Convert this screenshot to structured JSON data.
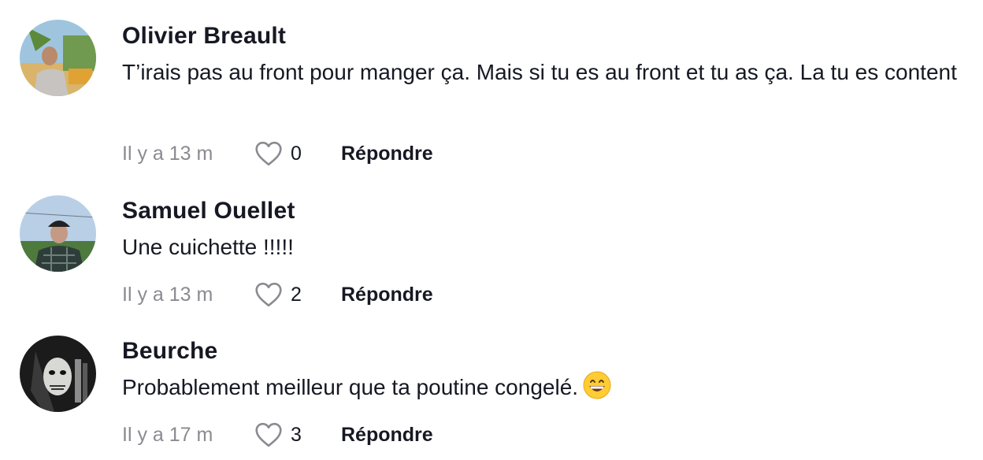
{
  "comments": [
    {
      "username": "Olivier Breault",
      "text": "T’irais pas au front pour manger ça. Mais si tu es au front et tu as ça. La tu es content",
      "time": "Il y a 13 m",
      "likes": "0",
      "reply_label": "Répondre",
      "avatar_icon": "avatar-photo-outdoor"
    },
    {
      "username": "Samuel Ouellet",
      "text": "Une cuichette !!!!!",
      "time": "Il y a 13 m",
      "likes": "2",
      "reply_label": "Répondre",
      "avatar_icon": "avatar-photo-cap"
    },
    {
      "username": "Beurche",
      "text": "Probablement meilleur que ta poutine congelé.",
      "emoji": "grinning-face-emoji",
      "time": "Il y a 17 m",
      "likes": "3",
      "reply_label": "Répondre",
      "avatar_icon": "avatar-photo-mask"
    }
  ],
  "colors": {
    "text": "#161823",
    "muted": "#8a8b91",
    "icon": "#8a8b91"
  },
  "icons": {
    "like": "heart-outline-icon"
  }
}
